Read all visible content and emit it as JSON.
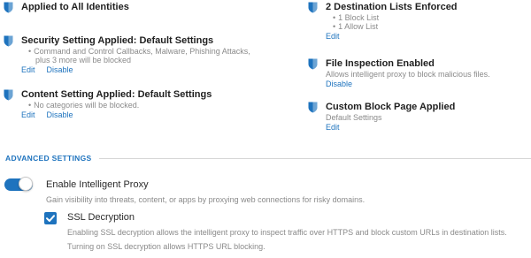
{
  "colors": {
    "accent": "#1e73be",
    "shield": "#1e73be",
    "muted_text": "#8a8a8a",
    "divider": "#d6d6d6"
  },
  "icons": {
    "block": "shield-icon",
    "toggle": "toggle-switch",
    "checkbox": "checkmark-icon"
  },
  "left_column": {
    "identities": {
      "title": "Applied to All Identities"
    },
    "security": {
      "title": "Security Setting Applied: Default Settings",
      "bullet_mark": "•",
      "bullet": "Command and Control Callbacks, Malware, Phishing Attacks,",
      "more": "plus 3 more will be blocked",
      "edit": "Edit",
      "disable": "Disable"
    },
    "content": {
      "title": "Content Setting Applied: Default Settings",
      "bullet_mark": "•",
      "bullet": "No categories will be blocked.",
      "edit": "Edit",
      "disable": "Disable"
    }
  },
  "right_column": {
    "destinations": {
      "title": "2 Destination Lists Enforced",
      "bullet_mark": "•",
      "items": [
        "1 Block List",
        "1 Allow List"
      ],
      "edit": "Edit"
    },
    "file_inspection": {
      "title": "File Inspection Enabled",
      "description": "Allows intelligent proxy to block malicious files.",
      "disable": "Disable"
    },
    "block_page": {
      "title": "Custom Block Page Applied",
      "description": "Default Settings",
      "edit": "Edit"
    }
  },
  "advanced": {
    "header": "ADVANCED SETTINGS",
    "intelligent_proxy": {
      "label": "Enable Intelligent Proxy",
      "description": "Gain visibility into threats, content, or apps by proxying web connections for risky domains.",
      "enabled": true
    },
    "ssl_decryption": {
      "label": "SSL Decryption",
      "description_line1": "Enabling SSL decryption allows the intelligent proxy to inspect traffic over HTTPS and block custom URLs in destination lists.",
      "description_line2": "Turning on SSL decryption allows HTTPS URL blocking.",
      "checked": true
    }
  }
}
